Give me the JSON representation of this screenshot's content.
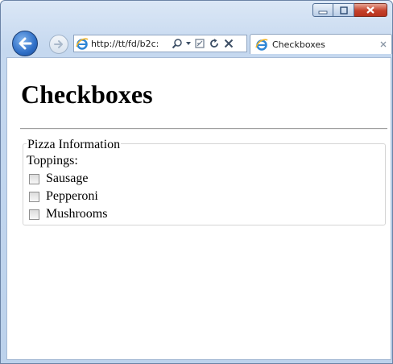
{
  "browser": {
    "address": {
      "url": "http://tt/fd/b2c:"
    },
    "tab": {
      "title": "Checkboxes"
    },
    "icons": {
      "back": "back-arrow-icon",
      "forward": "forward-arrow-icon",
      "site": "ie-page-icon",
      "search": "search-icon",
      "dropdown": "chevron-down-icon",
      "compat": "compatibility-view-icon",
      "refresh": "refresh-icon",
      "stop": "stop-icon",
      "tab_close": "close-icon"
    }
  },
  "page": {
    "title": "Checkboxes",
    "fieldset": {
      "legend": "Pizza Information",
      "label": "Toppings:",
      "options": [
        {
          "label": "Sausage",
          "checked": false
        },
        {
          "label": "Pepperoni",
          "checked": false
        },
        {
          "label": "Mushrooms",
          "checked": false
        }
      ]
    }
  },
  "colors": {
    "accent": "#2f6fc7",
    "close_button": "#c4412a"
  }
}
